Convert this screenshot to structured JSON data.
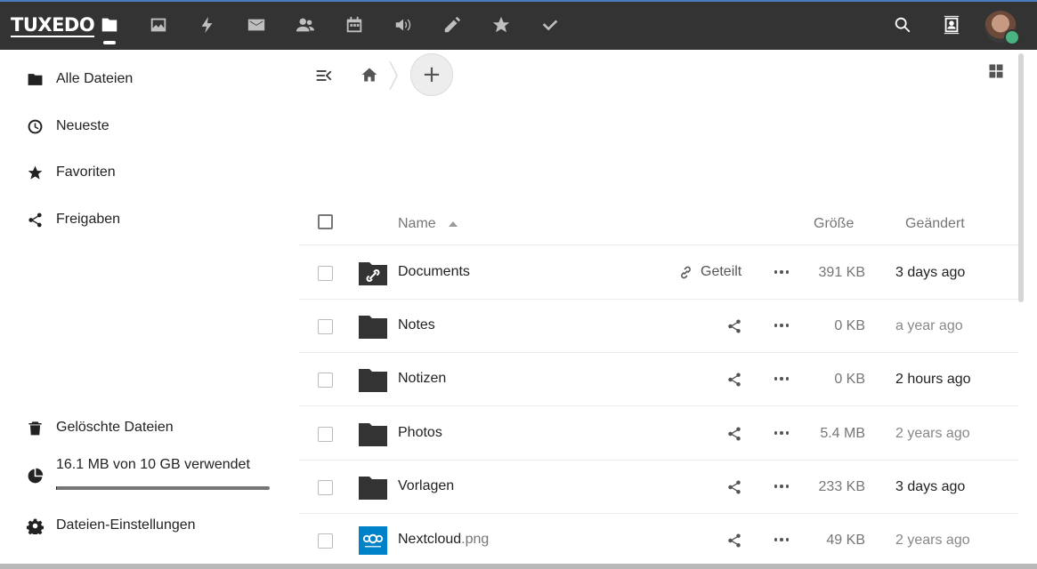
{
  "header": {
    "logo": "TUXEDO",
    "apps": [
      "folder-icon",
      "image-icon",
      "flash-icon",
      "mail-icon",
      "contacts-group-icon",
      "calendar-icon",
      "audio-icon",
      "pencil-icon",
      "star-icon",
      "checkmark-icon"
    ],
    "right_icons": [
      "search-icon",
      "contacts-icon"
    ]
  },
  "sidebar": {
    "items": [
      {
        "label": "Alle Dateien",
        "icon": "folder-icon"
      },
      {
        "label": "Neueste",
        "icon": "clock-icon"
      },
      {
        "label": "Favoriten",
        "icon": "star-icon"
      },
      {
        "label": "Freigaben",
        "icon": "share-icon"
      }
    ],
    "bottom": [
      {
        "label": "Gelöschte Dateien",
        "icon": "trash-icon"
      },
      {
        "label": "16.1 MB von 10 GB verwendet",
        "icon": "pie-chart-icon"
      },
      {
        "label": "Dateien-Einstellungen",
        "icon": "gear-icon"
      }
    ],
    "quota_fraction": 0.0016
  },
  "toolbar": {
    "add_label": "+"
  },
  "table": {
    "headers": {
      "name": "Name",
      "size": "Größe",
      "modified": "Geändert"
    },
    "rows": [
      {
        "name": "Documents",
        "ext": "",
        "shared_label": "Geteilt",
        "size": "391 KB",
        "date": "3 days ago",
        "date_color": "#222"
      },
      {
        "name": "Notes",
        "ext": "",
        "size": "0 KB",
        "date": "a year ago",
        "date_color": "#888"
      },
      {
        "name": "Notizen",
        "ext": "",
        "size": "0 KB",
        "date": "2 hours ago",
        "date_color": "#222"
      },
      {
        "name": "Photos",
        "ext": "",
        "size": "5.4 MB",
        "date": "2 years ago",
        "date_color": "#888"
      },
      {
        "name": "Vorlagen",
        "ext": "",
        "size": "233 KB",
        "date": "3 days ago",
        "date_color": "#222"
      },
      {
        "name": "Nextcloud",
        "ext": ".png",
        "size": "49 KB",
        "date": "2 years ago",
        "date_color": "#888"
      }
    ]
  },
  "colors": {
    "header_bg": "#333333",
    "accent": "#0082c9",
    "online": "#49b382"
  }
}
